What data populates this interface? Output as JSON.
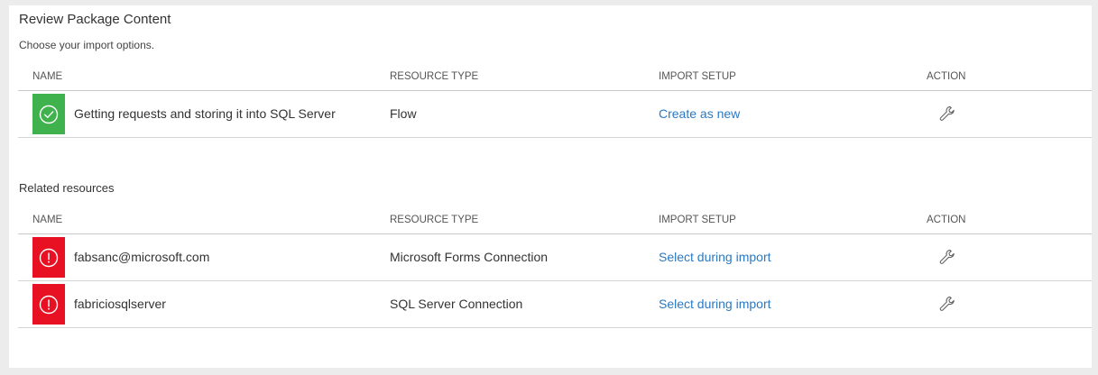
{
  "page": {
    "title": "Review Package Content",
    "subtitle": "Choose your import options."
  },
  "columns": {
    "name": "NAME",
    "resource_type": "RESOURCE TYPE",
    "import_setup": "IMPORT SETUP",
    "action": "ACTION"
  },
  "main_rows": [
    {
      "status": "ok",
      "status_icon": "check-circle-icon",
      "name": "Getting requests and storing it into SQL Server",
      "resource_type": "Flow",
      "import_setup": "Create as new",
      "action_icon": "wrench-icon"
    }
  ],
  "related": {
    "label": "Related resources",
    "rows": [
      {
        "status": "error",
        "status_icon": "error-circle-icon",
        "name": "fabsanc@microsoft.com",
        "resource_type": "Microsoft Forms Connection",
        "import_setup": "Select during import",
        "action_icon": "wrench-icon"
      },
      {
        "status": "error",
        "status_icon": "error-circle-icon",
        "name": "fabriciosqlserver",
        "resource_type": "SQL Server Connection",
        "import_setup": "Select during import",
        "action_icon": "wrench-icon"
      }
    ]
  },
  "colors": {
    "ok": "#3fb24e",
    "error": "#e81123",
    "link": "#2b79c2"
  }
}
